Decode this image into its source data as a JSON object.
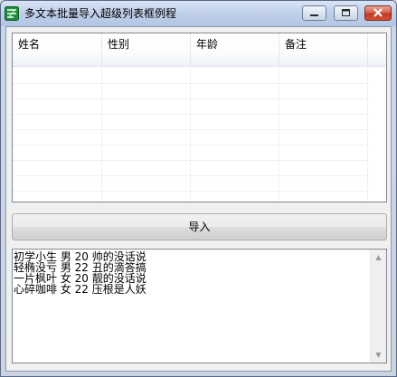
{
  "window": {
    "title": "多文本批量导入超级列表框例程",
    "icon": "app-icon",
    "controls": [
      "minimize-icon",
      "maximize-icon",
      "close-icon"
    ]
  },
  "listview": {
    "columns": [
      "姓名",
      "性别",
      "年龄",
      "备注"
    ],
    "rows": []
  },
  "import_button": {
    "label": "导入"
  },
  "memo": {
    "lines": [
      "初学小生 男 20 帅的没话说",
      "轻椭没亏 男 22 丑的滴答搞",
      "一片枫叶 女 20 靓的没话说",
      "心碎咖啡 女 22 压根是人妖"
    ]
  }
}
